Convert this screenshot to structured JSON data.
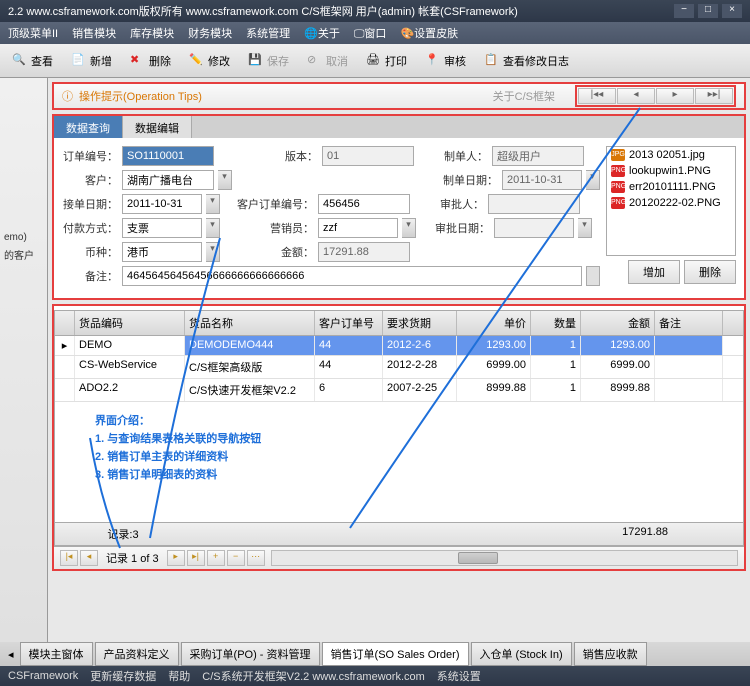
{
  "window": {
    "title": "2.2 www.csframework.com版权所有 www.csframework.com C/S框架网 用户(admin) 帐套(CSFramework)"
  },
  "menu": [
    "顶级菜单II",
    "销售模块",
    "库存模块",
    "财务模块",
    "系统管理",
    "🌐关于",
    "🖵窗口",
    "🎨设置皮肤"
  ],
  "toolbar": {
    "view": "查看",
    "add": "新增",
    "del": "删除",
    "edit": "修改",
    "save": "保存",
    "cancel": "取消",
    "print": "打印",
    "approve": "审核",
    "log": "查看修改日志"
  },
  "left": {
    "demo": "emo)",
    "cust": "的客户"
  },
  "tipbar": {
    "text": "操作提示(Operation Tips)",
    "link": "关于C/S框架"
  },
  "tabs": {
    "query": "数据查询",
    "edit": "数据编辑"
  },
  "form": {
    "order_no_l": "订单编号：",
    "order_no": "SO1110001",
    "version_l": "版本：",
    "version": "01",
    "maker_l": "制单人：",
    "maker": "超级用户",
    "customer_l": "客户：",
    "customer": "湖南广播电台",
    "make_date_l": "制单日期：",
    "make_date": "2011-10-31",
    "recv_date_l": "接单日期：",
    "recv_date": "2011-10-31",
    "cust_order_l": "客户订单编号：",
    "cust_order": "456456",
    "approver_l": "审批人：",
    "approver": "",
    "pay_l": "付款方式：",
    "pay": "支票",
    "sales_l": "营销员：",
    "sales": "zzf",
    "appr_date_l": "审批日期：",
    "appr_date": "",
    "currency_l": "币种：",
    "currency": "港币",
    "amount_l": "金额：",
    "amount": "17291.88",
    "remark_l": "备注：",
    "remark": "46456456456456666666666666666"
  },
  "files": {
    "items": [
      {
        "icon": "JPG",
        "color": "#d97706",
        "name": "2013 02051.jpg"
      },
      {
        "icon": "PNG",
        "color": "#dc2626",
        "name": "lookupwin1.PNG"
      },
      {
        "icon": "PNG",
        "color": "#dc2626",
        "name": "err20101111.PNG"
      },
      {
        "icon": "PNG",
        "color": "#dc2626",
        "name": "20120222-02.PNG"
      }
    ],
    "add": "增加",
    "del": "删除"
  },
  "grid": {
    "headers": [
      "",
      "货品编码",
      "货品名称",
      "客户订单号",
      "要求货期",
      "单价",
      "数量",
      "金额",
      "备注"
    ],
    "rows": [
      {
        "sel": true,
        "mark": "▸",
        "cells": [
          "DEMO",
          "DEMODEMO444",
          "44",
          "2012-2-6",
          "1293.00",
          "1",
          "1293.00",
          ""
        ]
      },
      {
        "sel": false,
        "mark": "",
        "cells": [
          "CS-WebService",
          "C/S框架高级版",
          "44",
          "2012-2-28",
          "6999.00",
          "1",
          "6999.00",
          ""
        ]
      },
      {
        "sel": false,
        "mark": "",
        "cells": [
          "ADO2.2",
          "C/S快速开发框架V2.2",
          "6",
          "2007-2-25",
          "8999.88",
          "1",
          "8999.88",
          ""
        ]
      }
    ],
    "record_count": "记录:3",
    "total": "17291.88"
  },
  "annotation": {
    "title": "界面介绍：",
    "l1": "1. 与查询结果表格关联的导航按钮",
    "l2": "2. 销售订单主表的详细资料",
    "l3": "3. 销售订单明细表的资料"
  },
  "paginator": {
    "text": "记录 1 of 3"
  },
  "bottomtabs": [
    "模块主窗体",
    "产品资料定义",
    "采购订单(PO) - 资料管理",
    "销售订单(SO Sales Order)",
    "入仓单 (Stock In)",
    "销售应收款"
  ],
  "status": [
    "CSFramework",
    "更新缓存数据",
    "帮助",
    "C/S系统开发框架V2.2 www.csframework.com",
    "系统设置"
  ]
}
